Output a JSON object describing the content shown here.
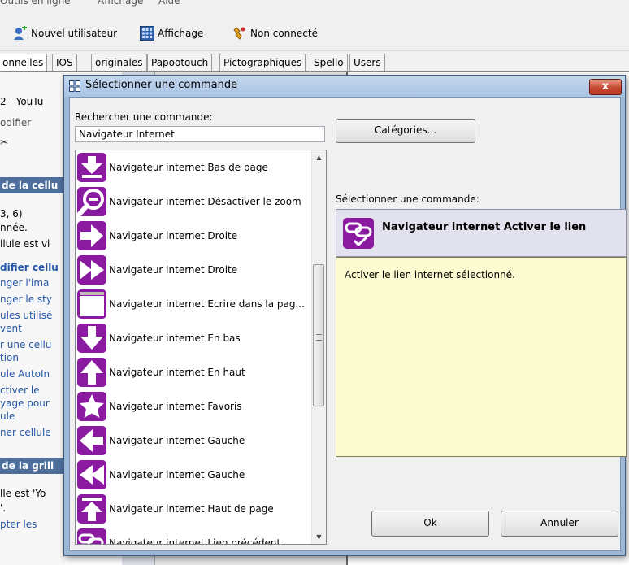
{
  "menubar": {
    "items": [
      "Outils en ligne",
      "Affichage",
      "Aide"
    ]
  },
  "toolbar": {
    "new_user": "Nouvel utilisateur",
    "view": "Affichage",
    "connection": "Non connecté"
  },
  "tabs": [
    "onnelles",
    "IOS",
    "originales",
    "Papootouch",
    "Pictographiques",
    "Spello",
    "Users"
  ],
  "background_left": [
    "2 - YouTu",
    "odifier",
    "de la cellu",
    "3, 6)",
    "nnée.",
    "llule est vi",
    "difier cellu",
    "nger l'ima",
    "nger le sty",
    "ules utilisé",
    "vent",
    "r une cellu",
    "tion",
    "ule AutoIn",
    "ctiver le",
    "yage pour",
    "ule",
    "ner cellule",
    "de la grill",
    "lle est 'Yo",
    "'.",
    "pter les"
  ],
  "dialog": {
    "title": "Sélectionner une commande",
    "close_label": "x",
    "search": {
      "label": "Rechercher une commande:",
      "value": "Navigateur Internet",
      "placeholder": ""
    },
    "categories_label": "Catégories...",
    "commands": [
      {
        "label": "Navigateur internet Bas de page",
        "icon": "arrow-down-bottom-icon"
      },
      {
        "label": "Navigateur internet Désactiver le zoom",
        "icon": "zoom-out-icon"
      },
      {
        "label": "Navigateur internet Droite",
        "icon": "arrow-right-icon"
      },
      {
        "label": "Navigateur internet Droite",
        "icon": "double-arrow-right-icon"
      },
      {
        "label": "Navigateur internet Ecrire dans la pag...",
        "icon": "page-blank-icon"
      },
      {
        "label": "Navigateur internet En bas",
        "icon": "arrow-down-icon"
      },
      {
        "label": "Navigateur internet En haut",
        "icon": "arrow-up-icon"
      },
      {
        "label": "Navigateur internet Favoris",
        "icon": "star-icon"
      },
      {
        "label": "Navigateur internet Gauche",
        "icon": "arrow-left-icon"
      },
      {
        "label": "Navigateur internet Gauche",
        "icon": "double-arrow-left-icon"
      },
      {
        "label": "Navigateur internet Haut de page",
        "icon": "arrow-up-top-icon"
      },
      {
        "label": "Navigateur internet Lien précédent",
        "icon": "link-icon"
      }
    ],
    "selected_label": "Sélectionner une commande:",
    "selected_command": "Navigateur internet Activer le lien",
    "description": "Activer le lien internet sélectionné.",
    "ok_label": "Ok",
    "cancel_label": "Annuler"
  },
  "colors": {
    "icon_purple": "#8a1aa0",
    "dialog_frame": "#9db7d6",
    "close_red": "#c74a33",
    "description_bg": "#fdfbd2"
  }
}
